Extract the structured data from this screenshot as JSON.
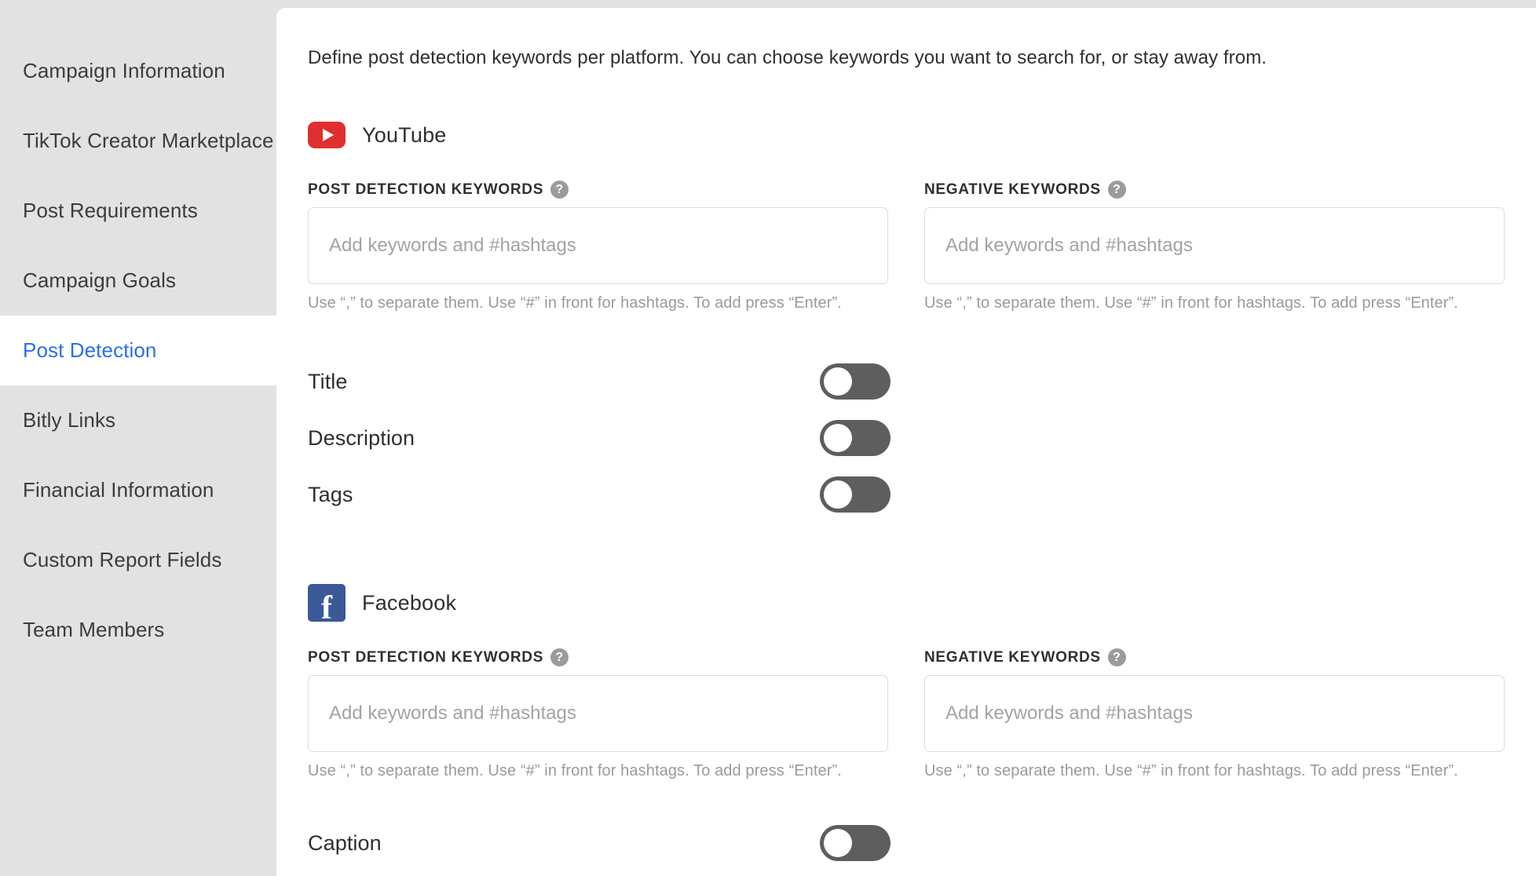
{
  "sidebar": {
    "items": [
      {
        "label": "Campaign Information",
        "active": false
      },
      {
        "label": "TikTok Creator Marketplace",
        "active": false
      },
      {
        "label": "Post Requirements",
        "active": false
      },
      {
        "label": "Campaign Goals",
        "active": false
      },
      {
        "label": "Post Detection",
        "active": true
      },
      {
        "label": "Bitly Links",
        "active": false
      },
      {
        "label": "Financial Information",
        "active": false
      },
      {
        "label": "Custom Report Fields",
        "active": false
      },
      {
        "label": "Team Members",
        "active": false
      }
    ]
  },
  "main": {
    "intro": "Define post detection keywords per platform. You can choose keywords you want to search for, or stay away from.",
    "help_glyph": "?",
    "platforms": [
      {
        "name": "YouTube",
        "icon": "youtube-icon",
        "fields": {
          "positive": {
            "label": "POST DETECTION KEYWORDS",
            "value": "",
            "placeholder": "Add keywords and #hashtags",
            "hint": "Use “,” to separate them. Use “#” in front for hashtags. To add press “Enter”."
          },
          "negative": {
            "label": "NEGATIVE KEYWORDS",
            "value": "",
            "placeholder": "Add keywords and #hashtags",
            "hint": "Use “,” to separate them. Use “#” in front for hashtags. To add press “Enter”."
          }
        },
        "toggles": [
          {
            "label": "Title",
            "state": "off"
          },
          {
            "label": "Description",
            "state": "off"
          },
          {
            "label": "Tags",
            "state": "off"
          }
        ]
      },
      {
        "name": "Facebook",
        "icon": "facebook-icon",
        "icon_glyph": "f",
        "fields": {
          "positive": {
            "label": "POST DETECTION KEYWORDS",
            "value": "",
            "placeholder": "Add keywords and #hashtags",
            "hint": "Use “,” to separate them. Use “#” in front for hashtags. To add press “Enter”."
          },
          "negative": {
            "label": "NEGATIVE KEYWORDS",
            "value": "",
            "placeholder": "Add keywords and #hashtags",
            "hint": "Use “,” to separate them. Use “#” in front for hashtags. To add press “Enter”."
          }
        },
        "toggles": [
          {
            "label": "Caption",
            "state": "off"
          }
        ]
      }
    ]
  },
  "colors": {
    "sidebar_bg": "#e2e2e2",
    "active_text": "#2a6ef0",
    "panel_bg": "#ffffff",
    "youtube_red": "#e02f2f",
    "facebook_blue": "#3b5998",
    "toggle_off": "#5e5e5e",
    "help_icon_gray": "#9b9b9b",
    "input_border": "#dcdcdc",
    "hint_text": "#9a9a9a"
  }
}
